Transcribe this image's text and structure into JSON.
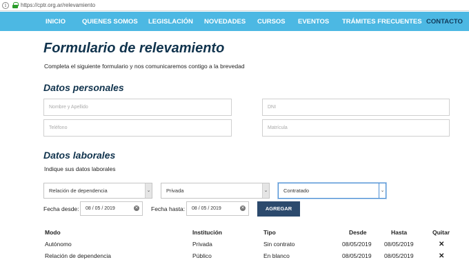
{
  "browser": {
    "url": "https://cptr.org.ar/relevamiento"
  },
  "nav": {
    "items": [
      "INICIO",
      "QUIENES SOMOS",
      "LEGISLACIÓN",
      "NOVEDADES",
      "CURSOS",
      "EVENTOS",
      "TRÁMITES FRECUENTES",
      "CONTACTO"
    ],
    "active": "CONTACTO"
  },
  "page": {
    "title": "Formulario de relevamiento",
    "intro": "Completa el siguiente formulario y nos comunicaremos contigo a la brevedad"
  },
  "personal": {
    "heading": "Datos personales",
    "name_placeholder": "Nombre y Apellido",
    "dni_placeholder": "DNI",
    "phone_placeholder": "Teléfono",
    "matricula_placeholder": "Matrícula"
  },
  "laboral": {
    "heading": "Datos laborales",
    "subtitle": "Indique sus datos laborales",
    "modo_selected": "Relación de dependencia",
    "institucion_selected": "Privada",
    "tipo_selected": "Contratado",
    "fecha_desde_label": "Fecha desde:",
    "fecha_desde_value": "08 / 05 / 2019",
    "fecha_hasta_label": "Fecha hasta:",
    "fecha_hasta_value": "08 / 05 / 2019",
    "add_button": "AGREGAR"
  },
  "table": {
    "headers": [
      "Modo",
      "Institución",
      "Tipo",
      "Desde",
      "Hasta",
      "Quitar"
    ],
    "rows": [
      {
        "modo": "Autónomo",
        "institucion": "Privada",
        "tipo": "Sin contrato",
        "desde": "08/05/2019",
        "hasta": "08/05/2019"
      },
      {
        "modo": "Relación de dependencia",
        "institucion": "Público",
        "tipo": "En blanco",
        "desde": "08/05/2019",
        "hasta": "08/05/2019"
      }
    ],
    "remove_glyph": "✕"
  },
  "icons": {
    "info": "info-icon",
    "lock": "lock-icon",
    "dropdown": "chevron-down-icon",
    "clear": "clear-icon",
    "remove": "close-icon"
  }
}
